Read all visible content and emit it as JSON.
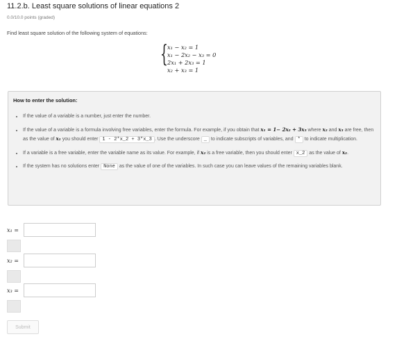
{
  "header": {
    "title": "11.2.b. Least square solutions of linear equations 2",
    "points": "0.0/10.0 points (graded)"
  },
  "problem": {
    "prompt": "Find least square solution of the following system of equations:",
    "equations": [
      "x₁ − x₂ = 1",
      "x₁ − 2x₂ − x₃ = 0",
      "2x₁ + 2x₃ = 1",
      "x₂ + x₃ = 1"
    ]
  },
  "help": {
    "title": "How to enter the solution:",
    "item1": "If the value of a variable is a number, just enter the number.",
    "item2_a": "If the value of a variable is a formula involving free variables, enter the formula. For example, if you obtain that",
    "item2_formula": "x₁ = 1− 2x₂ + 3x₃",
    "item2_b": "where",
    "item2_x2": "x₂",
    "item2_and": "and",
    "item2_x3": "x₃",
    "item2_c": "are free, then as the value of",
    "item2_x1": "x₁",
    "item2_d": "you should enter",
    "item2_code": "1 - 2*x_2 + 3*x_3",
    "item2_e": ". Use the underscore",
    "item2_underscore": "_",
    "item2_f": "to indicate subscripts of variables, and",
    "item2_star": "*",
    "item2_g": "to indicate multiplication.",
    "item3_a": "If a variable is a free variable, enter the variable name as its value. For example, if",
    "item3_var": "x₂",
    "item3_b": "is a free variable, then you should enter",
    "item3_code": "x_2",
    "item3_c": "as the value of",
    "item3_var2": "x₂",
    "item3_d": ".",
    "item4_a": "If the system has no solutions enter",
    "item4_code": "None",
    "item4_b": "as the value of one of the variables. In such case you can leave values of the remaining variables blank."
  },
  "answers": {
    "x1_label": "x₁ =",
    "x2_label": "x₂ =",
    "x3_label": "x₃ =",
    "x1_value": "",
    "x2_value": "",
    "x3_value": ""
  },
  "submit_label": "Submit"
}
